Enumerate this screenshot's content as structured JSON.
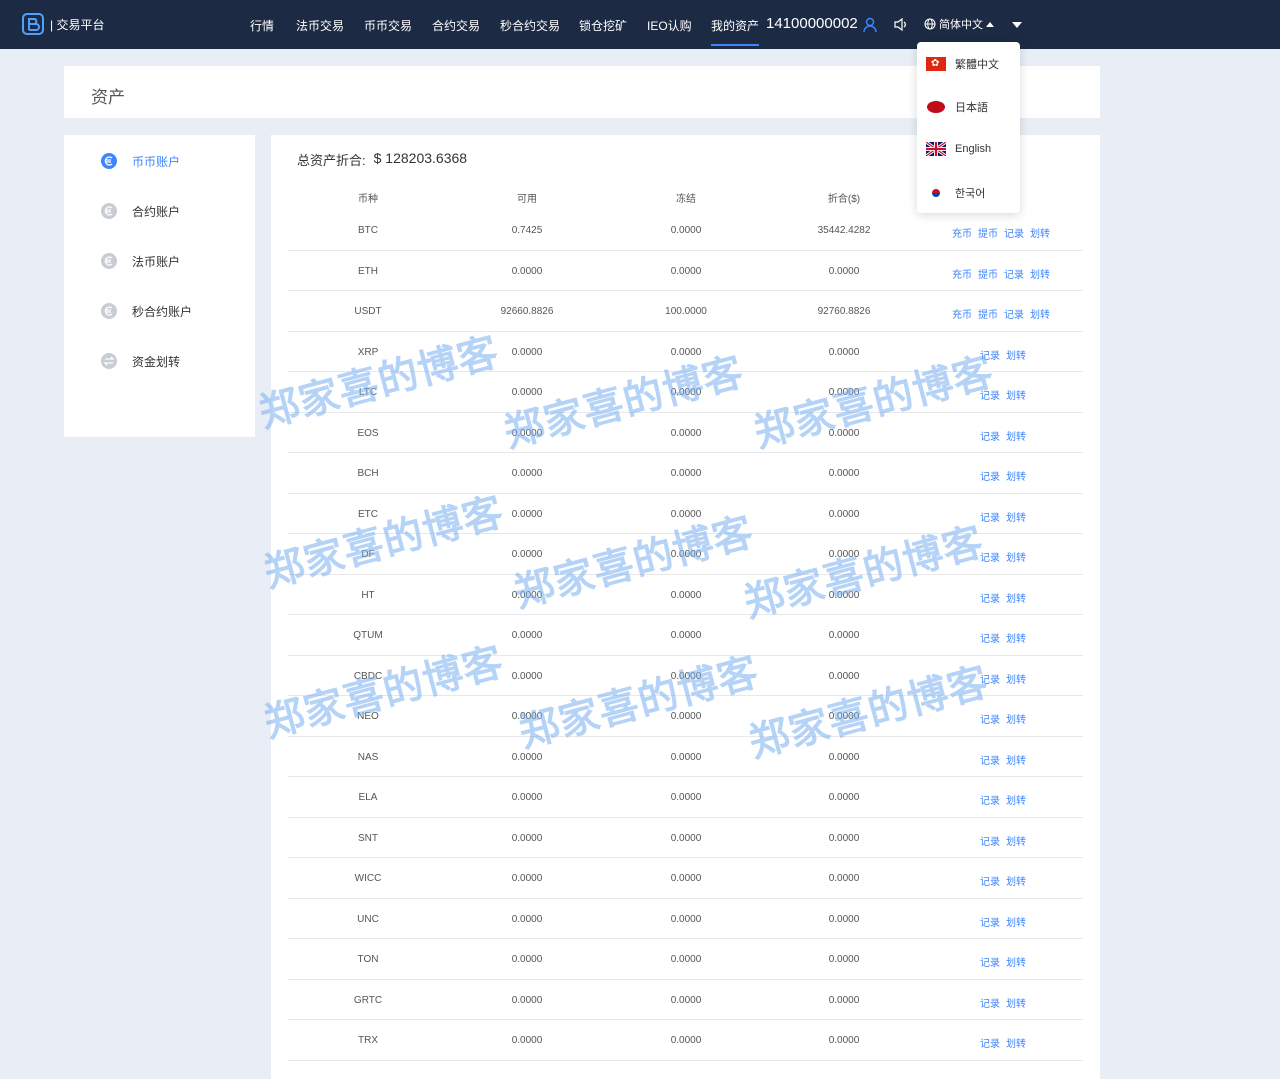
{
  "header": {
    "logo_text": "| 交易平台",
    "nav": [
      "行情",
      "法币交易",
      "币币交易",
      "合约交易",
      "秒合约交易",
      "锁仓挖矿",
      "IEO认购",
      "我的资产"
    ],
    "phone": "14100000002",
    "current_lang": "简体中文"
  },
  "lang_menu": [
    {
      "label": "繁體中文",
      "flag": "hk-flag"
    },
    {
      "label": "日本語",
      "flag": "jp-flag"
    },
    {
      "label": "English",
      "flag": "uk-flag"
    },
    {
      "label": "한국어",
      "flag": "kr-flag"
    }
  ],
  "page_title": "资产",
  "sidebar": [
    "币币账户",
    "合约账户",
    "法币账户",
    "秒合约账户",
    "资金划转"
  ],
  "total": {
    "label": "总资产折合:",
    "value": "$ 128203.6368"
  },
  "columns": [
    "币种",
    "可用",
    "冻结",
    "折合($)"
  ],
  "actions": {
    "recharge": "充币",
    "withdraw": "提币",
    "record": "记录",
    "transfer": "划转"
  },
  "rows": [
    {
      "coin": "BTC",
      "available": "0.7425",
      "frozen": "0.0000",
      "usd": "35442.4282",
      "full": true
    },
    {
      "coin": "ETH",
      "available": "0.0000",
      "frozen": "0.0000",
      "usd": "0.0000",
      "full": true
    },
    {
      "coin": "USDT",
      "available": "92660.8826",
      "frozen": "100.0000",
      "usd": "92760.8826",
      "full": true
    },
    {
      "coin": "XRP",
      "available": "0.0000",
      "frozen": "0.0000",
      "usd": "0.0000",
      "full": false
    },
    {
      "coin": "LTC",
      "available": "0.0000",
      "frozen": "0.0000",
      "usd": "0.0000",
      "full": false
    },
    {
      "coin": "EOS",
      "available": "0.0000",
      "frozen": "0.0000",
      "usd": "0.0000",
      "full": false
    },
    {
      "coin": "BCH",
      "available": "0.0000",
      "frozen": "0.0000",
      "usd": "0.0000",
      "full": false
    },
    {
      "coin": "ETC",
      "available": "0.0000",
      "frozen": "0.0000",
      "usd": "0.0000",
      "full": false
    },
    {
      "coin": "DF",
      "available": "0.0000",
      "frozen": "0.0000",
      "usd": "0.0000",
      "full": false
    },
    {
      "coin": "HT",
      "available": "0.0000",
      "frozen": "0.0000",
      "usd": "0.0000",
      "full": false
    },
    {
      "coin": "QTUM",
      "available": "0.0000",
      "frozen": "0.0000",
      "usd": "0.0000",
      "full": false
    },
    {
      "coin": "CBDC",
      "available": "0.0000",
      "frozen": "0.0000",
      "usd": "0.0000",
      "full": false
    },
    {
      "coin": "NEO",
      "available": "0.0000",
      "frozen": "0.0000",
      "usd": "0.0000",
      "full": false
    },
    {
      "coin": "NAS",
      "available": "0.0000",
      "frozen": "0.0000",
      "usd": "0.0000",
      "full": false
    },
    {
      "coin": "ELA",
      "available": "0.0000",
      "frozen": "0.0000",
      "usd": "0.0000",
      "full": false
    },
    {
      "coin": "SNT",
      "available": "0.0000",
      "frozen": "0.0000",
      "usd": "0.0000",
      "full": false
    },
    {
      "coin": "WICC",
      "available": "0.0000",
      "frozen": "0.0000",
      "usd": "0.0000",
      "full": false
    },
    {
      "coin": "UNC",
      "available": "0.0000",
      "frozen": "0.0000",
      "usd": "0.0000",
      "full": false
    },
    {
      "coin": "TON",
      "available": "0.0000",
      "frozen": "0.0000",
      "usd": "0.0000",
      "full": false
    },
    {
      "coin": "GRTC",
      "available": "0.0000",
      "frozen": "0.0000",
      "usd": "0.0000",
      "full": false
    },
    {
      "coin": "TRX",
      "available": "0.0000",
      "frozen": "0.0000",
      "usd": "0.0000",
      "full": false
    }
  ],
  "watermark": "郑家喜的博客",
  "colors": {
    "header_bg": "#1c2a44",
    "accent": "#3d86ff",
    "page_bg": "#e9eef6"
  }
}
